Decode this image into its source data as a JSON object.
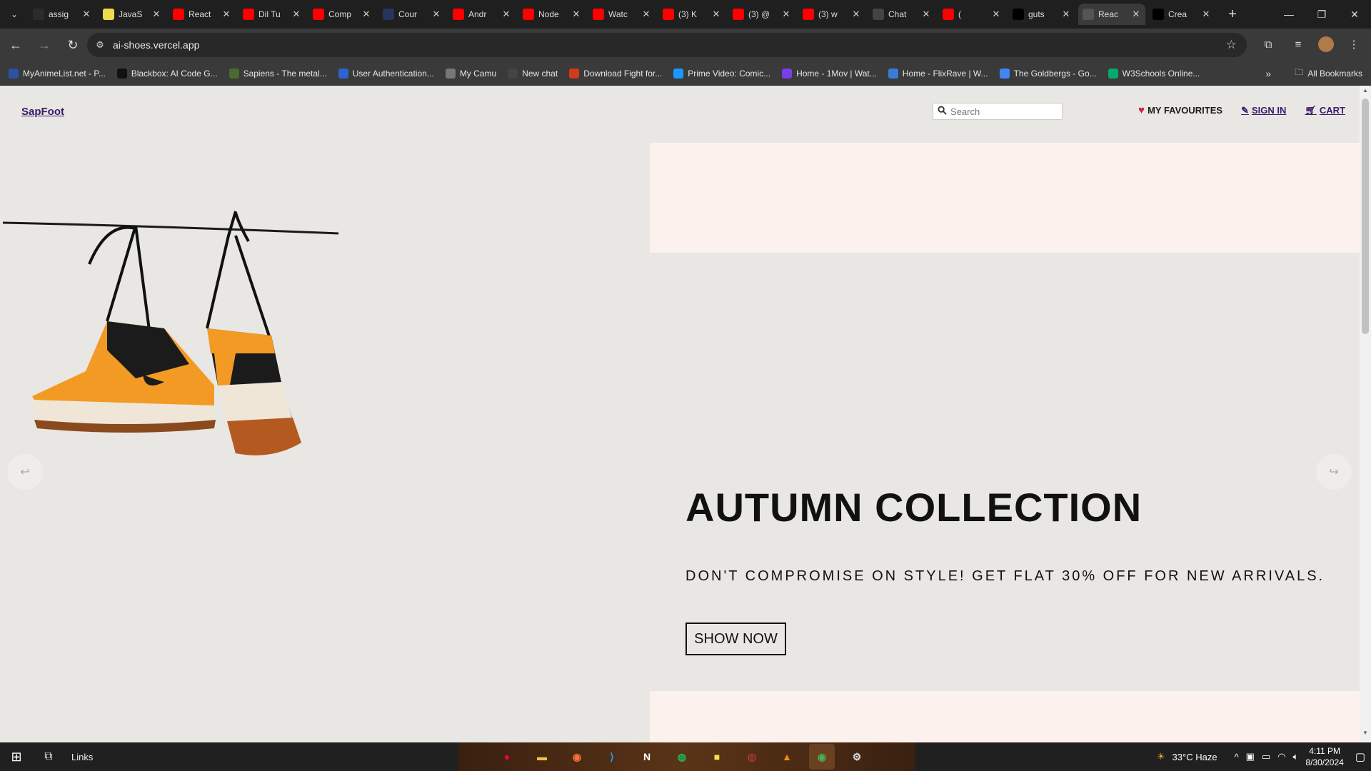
{
  "browser": {
    "tabs": [
      {
        "title": "assig",
        "icon": "github-icon",
        "color": "#2b2b2b"
      },
      {
        "title": "JavaS",
        "icon": "js-icon",
        "color": "#f0db4f"
      },
      {
        "title": "React",
        "icon": "youtube-icon",
        "color": "#ff0000"
      },
      {
        "title": "Dil Tu",
        "icon": "youtube-icon",
        "color": "#ff0000"
      },
      {
        "title": "Comp",
        "icon": "youtube-icon",
        "color": "#ff0000"
      },
      {
        "title": "Cour",
        "icon": "code-icon",
        "color": "#26355c"
      },
      {
        "title": "Andr",
        "icon": "youtube-icon",
        "color": "#ff0000"
      },
      {
        "title": "Node",
        "icon": "youtube-icon",
        "color": "#ff0000"
      },
      {
        "title": "Watc",
        "icon": "youtube-icon",
        "color": "#ff0000"
      },
      {
        "title": "(3) K",
        "icon": "youtube-icon",
        "color": "#ff0000"
      },
      {
        "title": "(3) @",
        "icon": "youtube-icon",
        "color": "#ff0000"
      },
      {
        "title": "(3) w",
        "icon": "youtube-icon",
        "color": "#ff0000"
      },
      {
        "title": "Chat",
        "icon": "chatgpt-icon",
        "color": "#444"
      },
      {
        "title": "(",
        "icon": "youtube-icon",
        "color": "#ff0000"
      },
      {
        "title": "guts",
        "icon": "vercel-icon",
        "color": "#000"
      },
      {
        "title": "Reac",
        "icon": "globe-icon",
        "color": "#555",
        "active": true
      },
      {
        "title": "Crea",
        "icon": "vercel-icon",
        "color": "#000"
      }
    ],
    "url": "ai-shoes.vercel.app",
    "bookmarks": [
      {
        "label": "MyAnimeList.net - P...",
        "color": "#2e51a2"
      },
      {
        "label": "Blackbox: AI Code G...",
        "color": "#111"
      },
      {
        "label": "Sapiens - The metal...",
        "color": "#4a6b2f"
      },
      {
        "label": "User Authentication...",
        "color": "#2d64d4"
      },
      {
        "label": "My Camu",
        "color": "#777"
      },
      {
        "label": "New chat",
        "color": "#444"
      },
      {
        "label": "Download Fight for...",
        "color": "#d23a1d"
      },
      {
        "label": "Prime Video: Comic...",
        "color": "#1a98ff"
      },
      {
        "label": "Home - 1Mov | Wat...",
        "color": "#7a3fe4"
      },
      {
        "label": "Home - FlixRave | W...",
        "color": "#3a7bd5"
      },
      {
        "label": "The Goldbergs - Go...",
        "color": "#4285f4"
      },
      {
        "label": "W3Schools Online...",
        "color": "#04aa6d"
      }
    ],
    "all_bookmarks": "All Bookmarks"
  },
  "site": {
    "brand": "SapFoot",
    "search_placeholder": "Search",
    "nav": {
      "favourites": "MY FAVOURITES",
      "signin": "SIGN IN",
      "cart": "CART"
    },
    "hero": {
      "title": "AUTUMN COLLECTION",
      "subtitle": "DON'T COMPROMISE ON STYLE! GET FLAT 30% OFF FOR NEW ARRIVALS.",
      "button": "SHOW NOW"
    },
    "colors": {
      "page_bg": "#e9e7e3",
      "panel_bg": "#fcf1ec",
      "brand": "#3b1a6b"
    }
  },
  "taskbar": {
    "links_label": "Links",
    "weather": "33°C Haze",
    "time": "4:11 PM",
    "date": "8/30/2024"
  }
}
